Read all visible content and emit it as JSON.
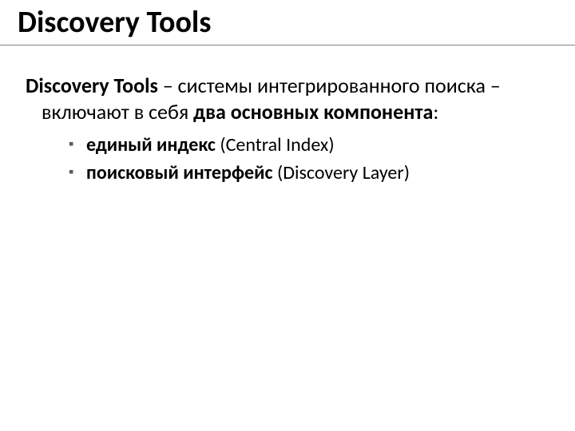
{
  "title": "Discovery Tools",
  "intro": {
    "leadBold": "Discovery Tools",
    "mid1": " – системы интегрированного поиска – включают в себя ",
    "mid2Bold": "два основных компонента",
    "tail": ":"
  },
  "bullets": [
    {
      "bold": "единый индекс",
      "rest": " (Central Index)"
    },
    {
      "bold": "поисковый интерфейс",
      "rest": " (Discovery Layer)"
    }
  ]
}
